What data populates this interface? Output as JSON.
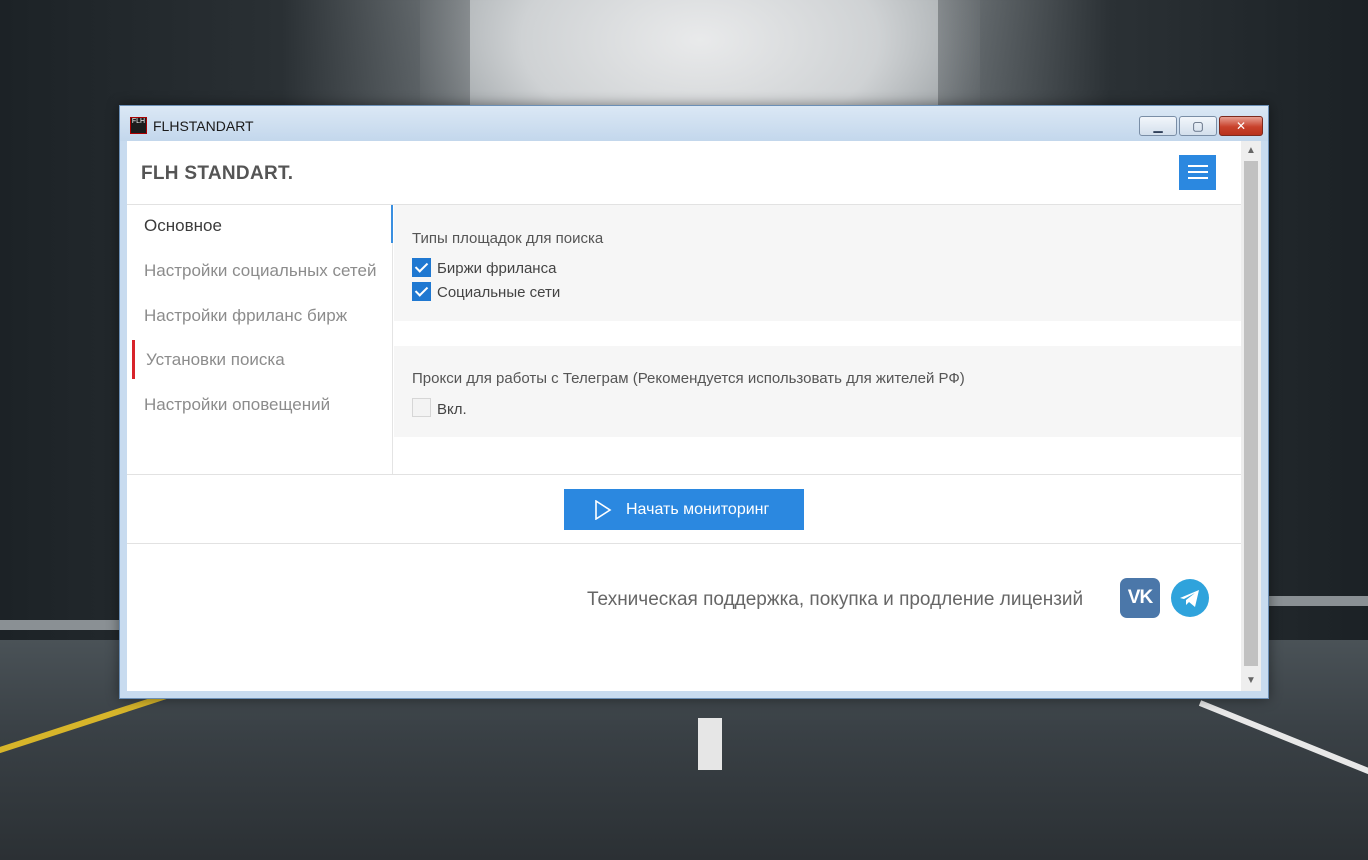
{
  "window": {
    "title": "FLHSTANDART",
    "icon_text": "FLH",
    "controls": {
      "minimize": "▁",
      "maximize": "▢",
      "close": "✕"
    }
  },
  "header": {
    "brand": "FLH STANDART.",
    "menu_icon": "hamburger-icon"
  },
  "sidebar": {
    "items": [
      {
        "label": "Основное",
        "state": "active"
      },
      {
        "label": "Настройки социальных сетей",
        "state": "normal"
      },
      {
        "label": "Настройки фриланс бирж",
        "state": "normal"
      },
      {
        "label": "Установки поиска",
        "state": "selected"
      },
      {
        "label": "Настройки оповещений",
        "state": "normal"
      }
    ]
  },
  "main": {
    "search_types": {
      "title": "Типы площадок для поиска",
      "options": [
        {
          "label": "Биржи фриланса",
          "checked": true
        },
        {
          "label": "Социальные сети",
          "checked": true
        }
      ]
    },
    "proxy": {
      "title": "Прокси для работы с Телеграм (Рекомендуется использовать для жителей РФ)",
      "option": {
        "label": "Вкл.",
        "checked": false
      }
    }
  },
  "actions": {
    "start_label": "Начать мониторинг",
    "start_icon": "play-icon"
  },
  "footer": {
    "support_text": "Техническая поддержка, покупка и продление лицензий",
    "vk_text": "VK",
    "vk_icon": "vk-icon",
    "telegram_icon": "telegram-icon"
  },
  "colors": {
    "accent": "#2b88e0",
    "selected_marker": "#d8232a",
    "checkbox_on": "#1f78d1"
  }
}
